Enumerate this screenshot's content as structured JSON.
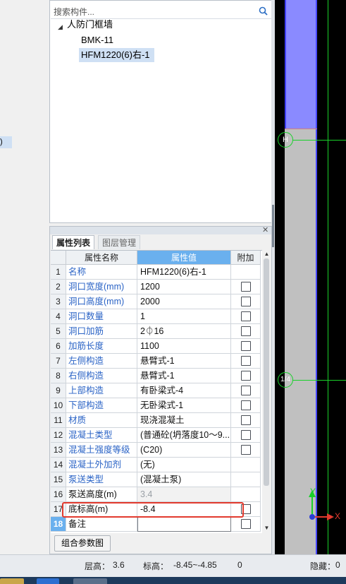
{
  "left_panel": {
    "selected_suffix": ")"
  },
  "tree": {
    "search_placeholder": "搜索构件...",
    "root_label": "人防门框墙",
    "children": [
      "BMK-11",
      "HFM1220(6)右-1"
    ],
    "selected_index": 1
  },
  "property_panel": {
    "tabs": [
      "属性列表",
      "图层管理"
    ],
    "active_tab": 0,
    "columns": [
      "属性名称",
      "属性值",
      "附加"
    ],
    "rows": [
      {
        "num": "1",
        "name": "名称",
        "value": "HFM1220(6)右-1",
        "style": "blue",
        "checkbox": false
      },
      {
        "num": "2",
        "name": "洞口宽度(mm)",
        "value": "1200",
        "style": "blue",
        "checkbox": true
      },
      {
        "num": "3",
        "name": "洞口高度(mm)",
        "value": "2000",
        "style": "blue",
        "checkbox": true
      },
      {
        "num": "4",
        "name": "洞口数量",
        "value": "1",
        "style": "blue",
        "checkbox": true
      },
      {
        "num": "5",
        "name": "洞口加筋",
        "value": "2⏀16",
        "style": "blue",
        "checkbox": true
      },
      {
        "num": "6",
        "name": "加筋长度",
        "value": "1100",
        "style": "blue",
        "checkbox": true
      },
      {
        "num": "7",
        "name": "左侧构造",
        "value": "悬臂式-1",
        "style": "blue",
        "checkbox": true
      },
      {
        "num": "8",
        "name": "右侧构造",
        "value": "悬臂式-1",
        "style": "blue",
        "checkbox": true
      },
      {
        "num": "9",
        "name": "上部构造",
        "value": "有卧梁式-4",
        "style": "blue",
        "checkbox": true
      },
      {
        "num": "10",
        "name": "下部构造",
        "value": "无卧梁式-1",
        "style": "blue",
        "checkbox": true
      },
      {
        "num": "11",
        "name": "材质",
        "value": "现浇混凝土",
        "style": "blue",
        "checkbox": true
      },
      {
        "num": "12",
        "name": "混凝土类型",
        "value": "(普通砼(坍落度10～9...",
        "style": "blue",
        "checkbox": true
      },
      {
        "num": "13",
        "name": "混凝土强度等级",
        "value": "(C20)",
        "style": "blue",
        "checkbox": true
      },
      {
        "num": "14",
        "name": "混凝土外加剂",
        "value": "(无)",
        "style": "blue",
        "checkbox": false
      },
      {
        "num": "15",
        "name": "泵送类型",
        "value": "(混凝土泵)",
        "style": "blue",
        "checkbox": false
      },
      {
        "num": "16",
        "name": "泵送高度(m)",
        "value": "3.4",
        "style": "black",
        "checkbox": false
      },
      {
        "num": "17",
        "name": "底标高(m)",
        "value": "-8.4",
        "style": "black",
        "checkbox": true
      },
      {
        "num": "18",
        "name": "备注",
        "value": "",
        "style": "black",
        "checkbox": true
      }
    ],
    "combo_button": "组合参数图"
  },
  "drawing": {
    "axis_labels": [
      "H",
      "1/4"
    ],
    "ucs_x": "X",
    "ucs_y": "Y"
  },
  "status": {
    "floor_height_label": "层高：",
    "floor_height": "3.6",
    "elevation_label": "标高：",
    "elevation": "-8.45~-4.85",
    "count": "0",
    "hidden_label": "隐藏：",
    "hidden": "0"
  },
  "colors": {
    "accent": "#6ab0ee",
    "highlight": "#e23a2e",
    "axis_green": "#19d12a",
    "link_blue": "#2a63c6"
  }
}
